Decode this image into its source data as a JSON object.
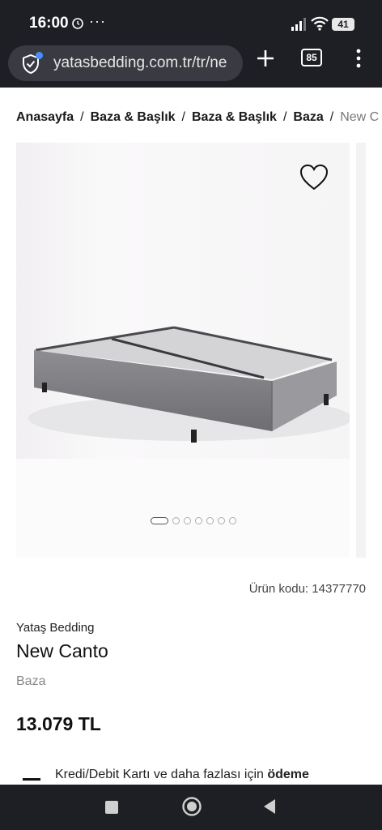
{
  "status": {
    "time": "16:00",
    "dots": "···",
    "battery": "41"
  },
  "browser": {
    "url": "yatasbedding.com.tr/tr/ne",
    "tab_count": "85"
  },
  "breadcrumb": {
    "items": [
      "Anasayfa",
      "Baza & Başlık",
      "Baza & Başlık",
      "Baza"
    ],
    "separator": "/",
    "current": "New C"
  },
  "gallery": {
    "slide_count": 7,
    "active_slide": 1
  },
  "product": {
    "code": "Ürün kodu: 14377770",
    "brand": "Yataş Bedding",
    "name": "New Canto",
    "category": "Baza",
    "price": "13.079 TL"
  },
  "payment": {
    "text": "Kredi/Debit Kartı ve daha fazlası için ",
    "bold": "ödeme"
  },
  "colors": {
    "chrome": "#1e1f24",
    "url_pill": "#3a3b42",
    "accent_dot": "#4d8df7"
  },
  "icons": [
    "alarm-icon",
    "signal-icon",
    "wifi-icon",
    "battery-icon",
    "shield-icon",
    "plus-icon",
    "tabs-icon",
    "menu-icon",
    "heart-icon",
    "recents-icon",
    "home-icon",
    "back-icon"
  ]
}
